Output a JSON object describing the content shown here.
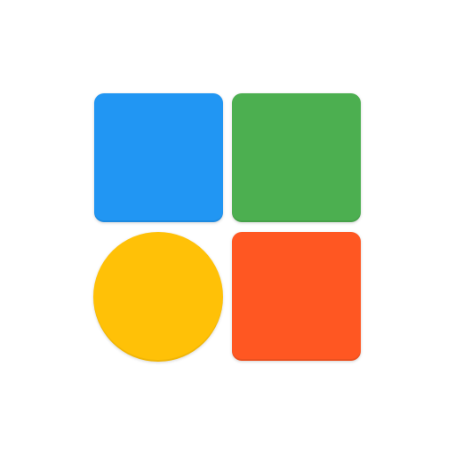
{
  "icon": {
    "name": "app-grid-logo-icon",
    "tiles": [
      {
        "id": "tile-blue",
        "shape": "rounded-square",
        "color": "#2196F3"
      },
      {
        "id": "tile-green",
        "shape": "rounded-square",
        "color": "#4CAF50"
      },
      {
        "id": "tile-yellow",
        "shape": "circle",
        "color": "#FFC107"
      },
      {
        "id": "tile-orange",
        "shape": "rounded-square",
        "color": "#FF5722"
      }
    ]
  }
}
